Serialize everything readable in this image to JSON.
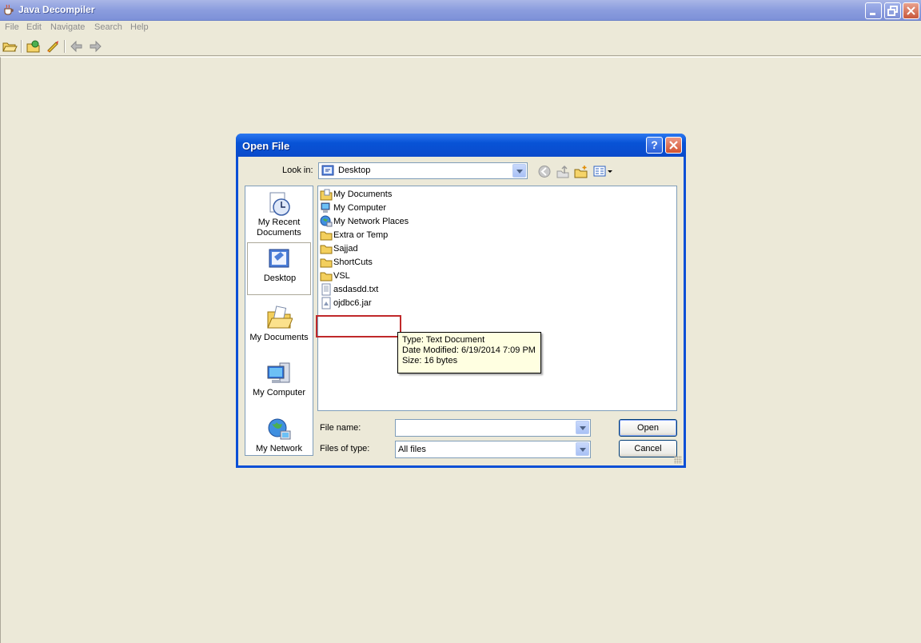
{
  "window": {
    "title": "Java Decompiler",
    "icon": "coffee-cup-icon"
  },
  "menu": {
    "items": [
      "File",
      "Edit",
      "Navigate",
      "Search",
      "Help"
    ]
  },
  "dialog": {
    "title": "Open File",
    "look_in_label": "Look in:",
    "look_in_value": "Desktop",
    "places": [
      {
        "label": "My Recent Documents"
      },
      {
        "label": "Desktop"
      },
      {
        "label": "My Documents"
      },
      {
        "label": "My Computer"
      },
      {
        "label": "My Network"
      }
    ],
    "files": [
      {
        "name": "My Documents",
        "icon": "my-documents-icon"
      },
      {
        "name": "My Computer",
        "icon": "my-computer-icon"
      },
      {
        "name": "My Network Places",
        "icon": "network-places-icon"
      },
      {
        "name": "Extra or Temp",
        "icon": "folder-icon"
      },
      {
        "name": "Sajjad",
        "icon": "folder-icon"
      },
      {
        "name": "ShortCuts",
        "icon": "folder-icon"
      },
      {
        "name": "VSL",
        "icon": "folder-icon"
      },
      {
        "name": "asdasdd.txt",
        "icon": "text-file-icon"
      },
      {
        "name": "ojdbc6.jar",
        "icon": "jar-file-icon"
      }
    ],
    "tooltip": {
      "type": "Type: Text Document",
      "modified": "Date Modified: 6/19/2014 7:09 PM",
      "size": "Size: 16 bytes"
    },
    "file_name_label": "File name:",
    "file_name_value": "",
    "files_of_type_label": "Files of type:",
    "files_of_type_value": "All files",
    "open_label": "Open",
    "cancel_label": "Cancel"
  }
}
